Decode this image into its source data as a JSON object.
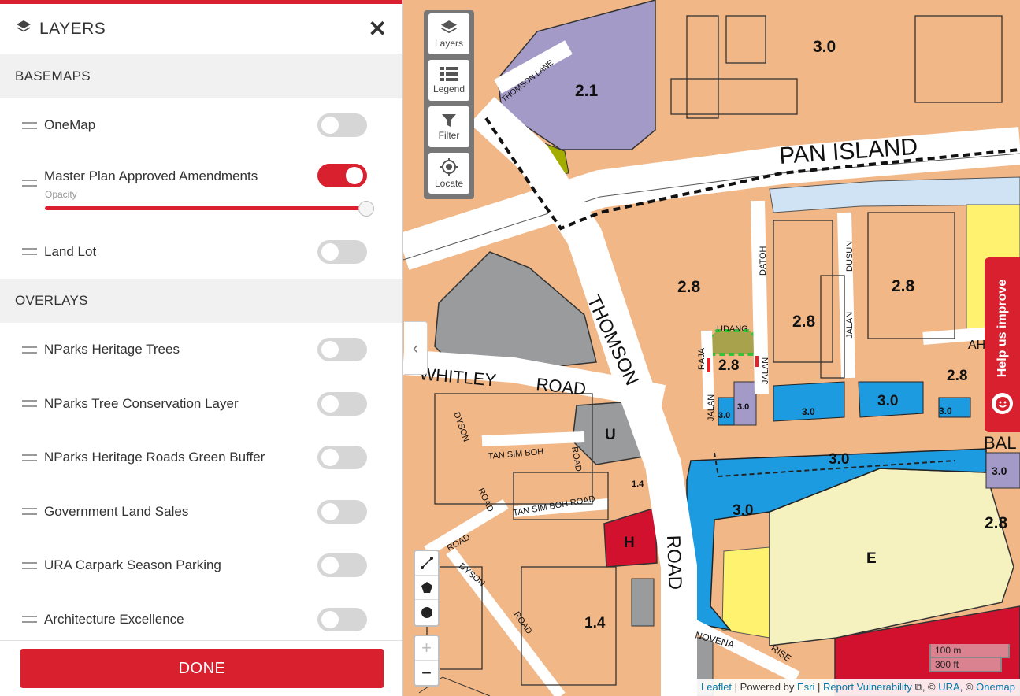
{
  "panel": {
    "title": "LAYERS",
    "close_label": "✕",
    "basemaps_heading": "BASEMAPS",
    "basemaps": [
      {
        "label": "OneMap",
        "enabled": false
      },
      {
        "label": "Master Plan Approved Amendments",
        "enabled": true,
        "opacity_label": "Opacity",
        "opacity": 1.0
      },
      {
        "label": "Land Lot",
        "enabled": false
      }
    ],
    "overlays_heading": "OVERLAYS",
    "overlays": [
      {
        "label": "NParks Heritage Trees",
        "enabled": false
      },
      {
        "label": "NParks Tree Conservation Layer",
        "enabled": false
      },
      {
        "label": "NParks Heritage Roads Green Buffer",
        "enabled": false
      },
      {
        "label": "Government Land Sales",
        "enabled": false
      },
      {
        "label": "URA Carpark Season Parking",
        "enabled": false
      },
      {
        "label": "Architecture Excellence",
        "enabled": false
      }
    ],
    "done_label": "DONE"
  },
  "map_toolbar": {
    "layers": "Layers",
    "legend": "Legend",
    "filter": "Filter",
    "locate": "Locate"
  },
  "zoom": {
    "in": "+",
    "out": "−"
  },
  "scale": {
    "metric": "100 m",
    "imperial": "300 ft"
  },
  "attribution": {
    "leaflet": "Leaflet",
    "sep1": " | Powered by ",
    "esri": "Esri",
    "sep2": " | ",
    "report": "Report Vulnerability",
    "ext_icon": "⧉",
    "sep3": ", © ",
    "ura": "URA",
    "sep4": ", © ",
    "onemap": "Onemap"
  },
  "feedback": {
    "label": "Help us improve"
  },
  "map_labels": {
    "plot_ratios": [
      "2.1",
      "3.0",
      "2.8",
      "2.8",
      "2.8",
      "2.8",
      "2.8",
      "3.0",
      "3.0",
      "3.0",
      "3.0",
      "3.0",
      "3.0",
      "3.0",
      "3.0",
      "2.8",
      "1.4",
      "1.4"
    ],
    "zones": [
      "U",
      "H",
      "E"
    ],
    "roads": [
      "PAN ISLAND",
      "THOMSON",
      "ROAD",
      "WHITLEY",
      "ROAD",
      "THOMSON LANE",
      "DATOH",
      "DUSUN",
      "JALAN",
      "JALAN",
      "UDANG",
      "RAJA",
      "JALAN",
      "DYSON",
      "TAN SIM BOH",
      "ROAD",
      "TAN SIM BOH ROAD",
      "ROAD",
      "ROAD",
      "DYSON",
      "ROAD",
      "NOVENA",
      "RISE",
      "AH",
      "BAL"
    ]
  }
}
